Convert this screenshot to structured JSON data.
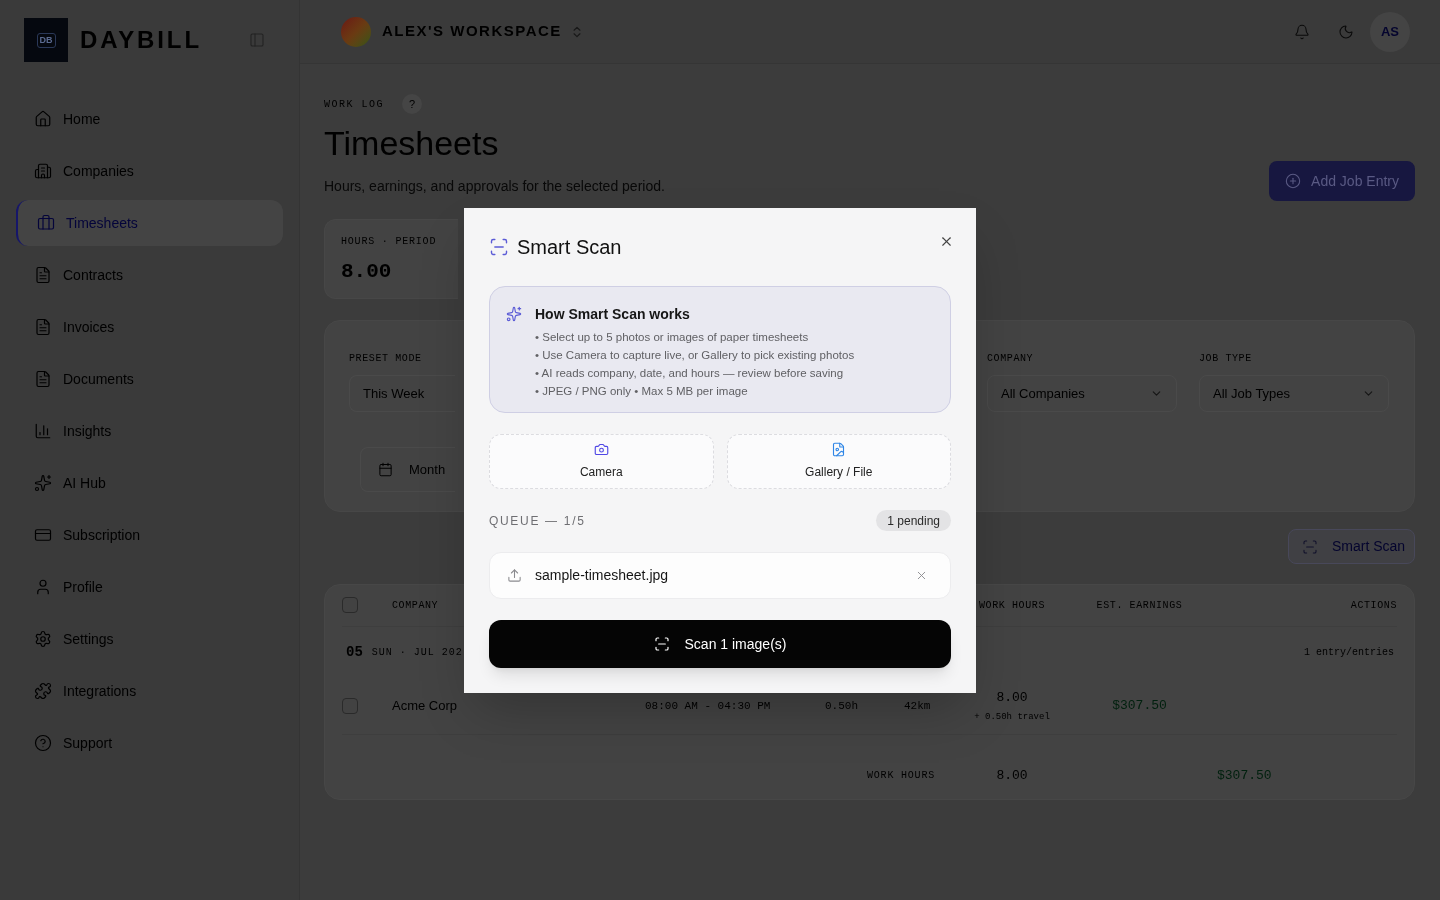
{
  "sidebar": {
    "logo_mark": "DB",
    "brand": "DAYBILL",
    "items": [
      {
        "label": "Home",
        "selected": false
      },
      {
        "label": "Companies",
        "selected": false
      },
      {
        "label": "Timesheets",
        "selected": true
      },
      {
        "label": "Contracts",
        "selected": false
      },
      {
        "label": "Invoices",
        "selected": false
      },
      {
        "label": "Documents",
        "selected": false
      },
      {
        "label": "Insights",
        "selected": false
      },
      {
        "label": "AI Hub",
        "selected": false
      },
      {
        "label": "Subscription",
        "selected": false
      },
      {
        "label": "Profile",
        "selected": false
      },
      {
        "label": "Settings",
        "selected": false
      },
      {
        "label": "Integrations",
        "selected": false
      },
      {
        "label": "Support",
        "selected": false
      }
    ]
  },
  "header": {
    "workspace": "ALEX'S WORKSPACE",
    "avatar": "AS"
  },
  "page": {
    "eyebrow": "WORK LOG",
    "help": "?",
    "title": "Timesheets",
    "subtitle": "Hours, earnings, and approvals for the selected period.",
    "primary_button": "Add Job Entry"
  },
  "stats": [
    {
      "label": "HOURS · PERIOD",
      "value": "8.00"
    }
  ],
  "filters": {
    "preset": {
      "label": "PRESET MODE",
      "value": "This Week"
    },
    "range_button": "Month",
    "selects": [
      {
        "label": "COMPANY",
        "value": "All Companies"
      },
      {
        "label": "JOB TYPE",
        "value": "All Job Types"
      }
    ]
  },
  "smart_scan_button": "Smart Scan",
  "table": {
    "all_checked": false,
    "columns": [
      {
        "label": "COMPANY"
      },
      {
        "label": "WORK HOURS"
      },
      {
        "label": "EST. EARNINGS"
      },
      {
        "label": "ACTIONS"
      }
    ],
    "groups": [
      {
        "day": "05",
        "date": "SUN · JUL 202",
        "count": "1 entry/entries",
        "rows": [
          {
            "checked": false,
            "company": "Acme Corp",
            "time_range": "08:00 AM - 04:30 PM",
            "column_3": "0.50h",
            "column_4": "42km",
            "work_hours": "8.00",
            "travel": "+ 0.50h travel",
            "earnings": "$307.50"
          }
        ]
      }
    ],
    "totals": {
      "label": "WORK HOURS",
      "hours": "8.00",
      "earnings": "$307.50"
    }
  },
  "modal": {
    "title": "Smart Scan",
    "info": {
      "title": "How Smart Scan works",
      "bullets": [
        "• Select up to 5 photos or images of paper timesheets",
        "• Use Camera to capture live, or Gallery to pick existing photos",
        "• AI reads company, date, and hours — review before saving",
        "• JPEG / PNG only • Max 5 MB per image"
      ]
    },
    "sources": [
      {
        "label": "Camera"
      },
      {
        "label": "Gallery / File"
      }
    ],
    "queue": {
      "label": "QUEUE — 1/5",
      "badge": "1 pending"
    },
    "files": [
      {
        "name": "sample-timesheet.jpg"
      }
    ],
    "scan_button": "Scan 1 image(s)"
  }
}
